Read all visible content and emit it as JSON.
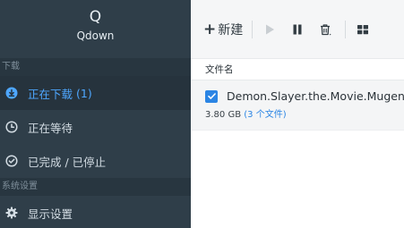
{
  "brand": {
    "logo": "Q",
    "name": "Qdown"
  },
  "sidebar": {
    "section_downloads": "下载",
    "items": [
      {
        "label": "正在下载",
        "count": "(1)",
        "icon": "download-circle-icon"
      },
      {
        "label": "正在等待",
        "icon": "clock-icon"
      },
      {
        "label": "已完成 / 已停止",
        "icon": "check-circle-icon"
      }
    ],
    "section_settings": "系统设置",
    "settings_item": {
      "label": "显示设置",
      "icon": "gear-icon"
    }
  },
  "toolbar": {
    "new_label": "新建",
    "icons": [
      "plus-icon",
      "play-icon",
      "pause-icon",
      "delete-icon",
      "grid-icon"
    ]
  },
  "table": {
    "header": "文件名"
  },
  "task": {
    "name": "Demon.Slayer.the.Movie.Mugen.",
    "size": "3.80 GB",
    "files": "(3 个文件)",
    "checked": true
  },
  "colors": {
    "sidebar_bg": "#2f3e49",
    "accent": "#4ea7ff",
    "checkbox": "#2b85e4"
  }
}
